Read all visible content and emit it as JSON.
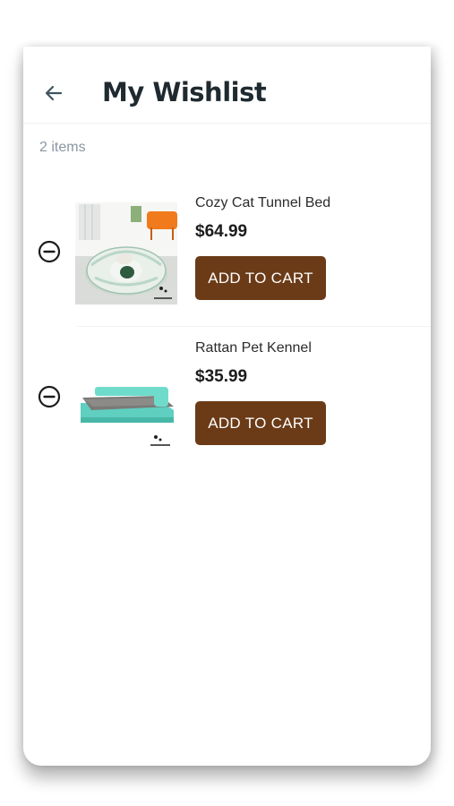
{
  "header": {
    "back_icon": "arrow-left-icon",
    "title": "My Wishlist"
  },
  "summary": {
    "count_text": "2 items"
  },
  "items": [
    {
      "name": "Cozy Cat Tunnel Bed",
      "price": "$64.99",
      "button_label": "ADD TO CART",
      "remove_icon": "minus-circle-icon"
    },
    {
      "name": "Rattan Pet Kennel",
      "price": "$35.99",
      "button_label": "ADD TO CART",
      "remove_icon": "minus-circle-icon"
    }
  ],
  "colors": {
    "accent": "#6b3b17",
    "title": "#1f2a30",
    "muted": "#8a96a0"
  }
}
